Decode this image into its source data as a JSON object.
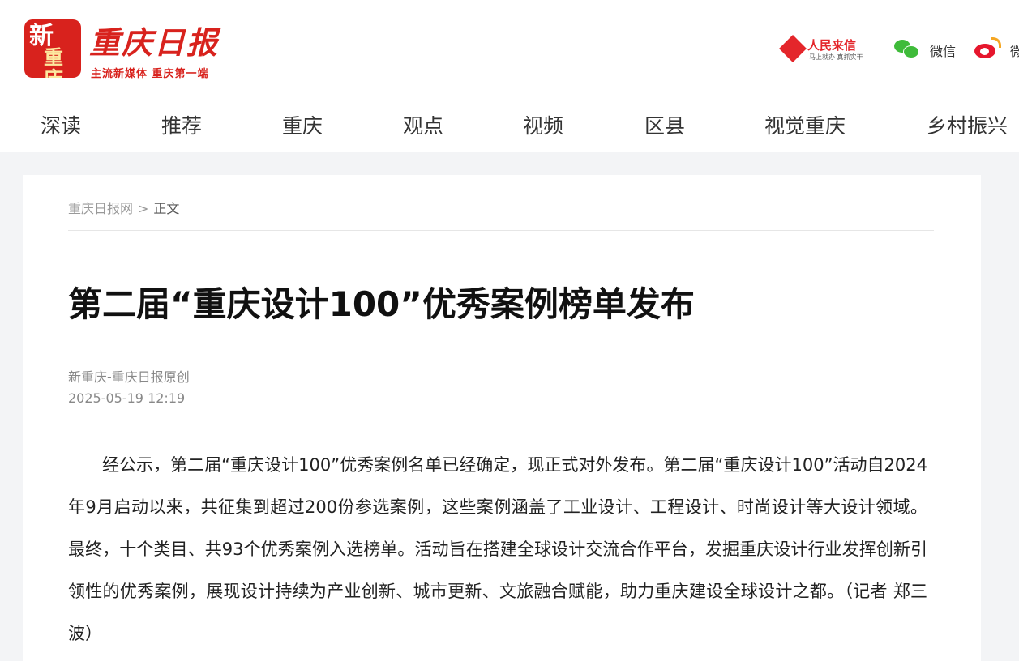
{
  "header": {
    "logo_char1": "新",
    "logo_char2": "重庆",
    "logo_title": "重庆日报",
    "logo_slogan": "主流新媒体 重庆第一端",
    "rmlx_title": "人民来信",
    "rmlx_sub": "马上就办 真抓实干",
    "wechat_label": "微信",
    "weibo_label": "微"
  },
  "nav": {
    "items": [
      "深读",
      "推荐",
      "重庆",
      "观点",
      "视频",
      "区县",
      "视觉重庆",
      "乡村振兴"
    ]
  },
  "breadcrumb": {
    "home": "重庆日报网",
    "separator": ">",
    "current": "正文"
  },
  "article": {
    "title": "第二届“重庆设计100”优秀案例榜单发布",
    "source": "新重庆-重庆日报原创",
    "date": "2025-05-19 12:19",
    "body": "经公示，第二届“重庆设计100”优秀案例名单已经确定，现正式对外发布。第二届“重庆设计100”活动自2024年9月启动以来，共征集到超过200份参选案例，这些案例涵盖了工业设计、工程设计、时尚设计等大设计领域。最终，十个类目、共93个优秀案例入选榜单。活动旨在搭建全球设计交流合作平台，发掘重庆设计行业发挥创新引领性的优秀案例，展现设计持续为产业创新、城市更新、文旅融合赋能，助力重庆建设全球设计之都。（记者 郑三波）"
  },
  "colors": {
    "brand_red": "#d8221d",
    "wechat_green": "#3fbb3a",
    "weibo_red": "#e6162d",
    "page_bg": "#f3f4f6"
  }
}
